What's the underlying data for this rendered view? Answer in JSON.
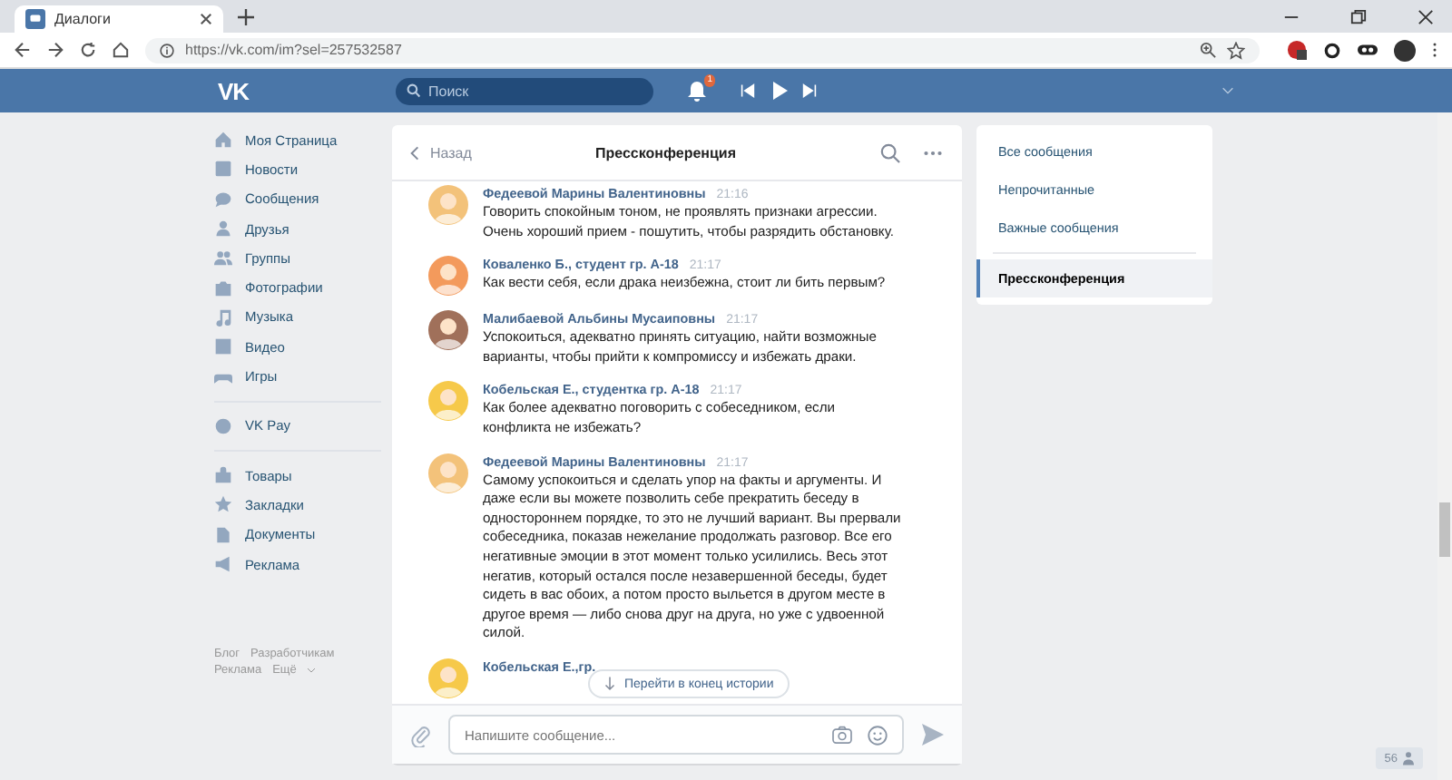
{
  "browser": {
    "tab": {
      "title": "Диалоги"
    },
    "url": "https://vk.com/im?sel=257532587"
  },
  "header": {
    "logo": "VK",
    "search": {
      "placeholder": "Поиск"
    },
    "notifications_badge": "1"
  },
  "nav": {
    "groups": [
      [
        {
          "label": "Моя Страница"
        },
        {
          "label": "Новости"
        },
        {
          "label": "Сообщения"
        },
        {
          "label": "Друзья"
        },
        {
          "label": "Группы"
        },
        {
          "label": "Фотографии"
        },
        {
          "label": "Музыка"
        },
        {
          "label": "Видео"
        },
        {
          "label": "Игры"
        }
      ],
      [
        {
          "label": "VK Pay"
        }
      ],
      [
        {
          "label": "Товары"
        },
        {
          "label": "Закладки"
        },
        {
          "label": "Документы"
        },
        {
          "label": "Реклама"
        }
      ]
    ],
    "footer_links": [
      "Блог",
      "Разработчикам",
      "Реклама",
      "Ещё"
    ]
  },
  "chat": {
    "back": "Назад",
    "title": "Прессконференция",
    "messages": [
      {
        "author": "Федеевой Марины Валентиновны",
        "time": "21:16",
        "text": "Говорить спокойным тоном, не проявлять признаки агрессии. Очень хороший прием - пошутить, чтобы разрядить обстановку."
      },
      {
        "author": "Коваленко Б., студент гр. А-18",
        "time": "21:17",
        "text": "Как вести себя, если драка неизбежна, стоит ли бить первым?"
      },
      {
        "author": "Малибаевой Альбины Мусаиповны",
        "time": "21:17",
        "text": "Успокоиться, адекватно принять ситуацию, найти возможные варианты, чтобы прийти к компромиссу и избежать драки."
      },
      {
        "author": "Кобельская Е., студентка гр. А-18",
        "time": "21:17",
        "text": "Как более адекватно поговорить с собеседником, если конфликта не избежать?"
      },
      {
        "author": "Федеевой Марины Валентиновны",
        "time": "21:17",
        "text": "Самому успокоиться и сделать упор на факты и аргументы. И даже если вы можете позволить себе прекратить беседу в одностороннем порядке, то это не лучший вариант. Вы прервали собеседника, показав нежелание продолжать разговор. Все его негативные эмоции в этот момент только усилились. Весь этот негатив, который остался после незавершенной беседы, будет сидеть в вас обоих, а потом просто выльется в другом месте в другое время — либо снова друг на друга, но уже с удвоенной силой."
      },
      {
        "author": "Кобельская Е.,гр."
      }
    ],
    "jump_button": "Перейти в конец истории",
    "composer": {
      "placeholder": "Напишите сообщение..."
    }
  },
  "folders": [
    {
      "label": "Все сообщения",
      "selected": false
    },
    {
      "label": "Непрочитанные",
      "selected": false
    },
    {
      "label": "Важные сообщения",
      "selected": false
    },
    {
      "label": "Прессконференция",
      "selected": true
    }
  ],
  "online_count": "56"
}
